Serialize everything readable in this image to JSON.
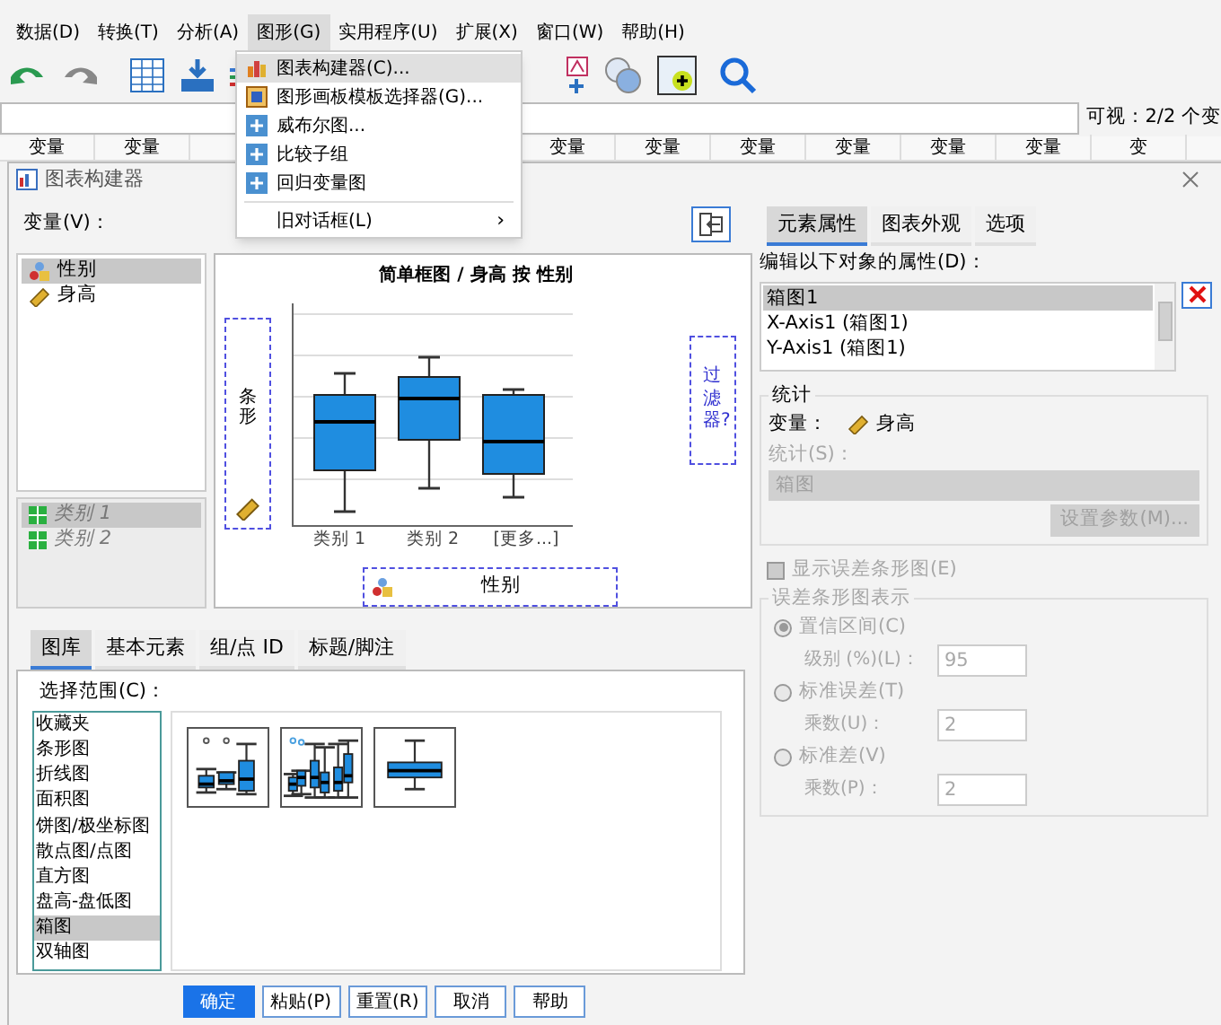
{
  "menu_bar": [
    {
      "label": "数据(D)",
      "selected": false
    },
    {
      "label": "转换(T)",
      "selected": false
    },
    {
      "label": "分析(A)",
      "selected": false
    },
    {
      "label": "图形(G)",
      "selected": true
    },
    {
      "label": "实用程序(U)",
      "selected": false
    },
    {
      "label": "扩展(X)",
      "selected": false
    },
    {
      "label": "窗口(W)",
      "selected": false
    },
    {
      "label": "帮助(H)",
      "selected": false
    }
  ],
  "data_view": {
    "visible_count": "可视：2/2 个变",
    "headers_left": [
      "变量",
      "变量"
    ],
    "headers_right": [
      "变量",
      "变量",
      "变量",
      "变量",
      "变量",
      "变量",
      "变"
    ]
  },
  "graphs_menu": [
    {
      "label": "图表构建器(C)...",
      "selected": true,
      "kind": "builder"
    },
    {
      "label": "图形画板模板选择器(G)...",
      "selected": false,
      "kind": "board"
    },
    {
      "label": "威布尔图...",
      "selected": false,
      "kind": "plus"
    },
    {
      "label": "比较子组",
      "selected": false,
      "kind": "plus"
    },
    {
      "label": "回归变量图",
      "selected": false,
      "kind": "plus"
    },
    {
      "label": "旧对话框(L)",
      "selected": false,
      "kind": "submenu",
      "arrow": "›"
    }
  ],
  "dialog": {
    "title": "图表构建器",
    "variables_label": "变量(V)：",
    "variables": [
      {
        "label": "性别",
        "selected": true,
        "kind": "nominal"
      },
      {
        "label": "身高",
        "selected": false,
        "kind": "scale"
      }
    ],
    "categories": [
      {
        "label": "类别 1",
        "selected": true
      },
      {
        "label": "类别 2",
        "selected": false
      }
    ],
    "canvas": {
      "title": "简单框图 / 身高 按 性别",
      "y_zone": "条形",
      "x_zone": "性别",
      "filter_zone": "过滤器?",
      "x_labels": [
        "类别 1",
        "类别 2",
        "[更多...]"
      ]
    },
    "gallery_tabs": [
      {
        "label": "图库",
        "selected": true
      },
      {
        "label": "基本元素",
        "selected": false
      },
      {
        "label": "组/点 ID",
        "selected": false
      },
      {
        "label": "标题/脚注",
        "selected": false
      }
    ],
    "choose_from_label": "选择范围(C)：",
    "chart_types": [
      {
        "label": "收藏夹",
        "selected": false
      },
      {
        "label": "条形图",
        "selected": false
      },
      {
        "label": "折线图",
        "selected": false
      },
      {
        "label": "面积图",
        "selected": false
      },
      {
        "label": "饼图/极坐标图",
        "selected": false
      },
      {
        "label": "散点图/点图",
        "selected": false
      },
      {
        "label": "直方图",
        "selected": false
      },
      {
        "label": "盘高-盘低图",
        "selected": false
      },
      {
        "label": "箱图",
        "selected": true
      },
      {
        "label": "双轴图",
        "selected": false
      }
    ],
    "gallery": [
      {
        "kind": "simple"
      },
      {
        "kind": "clustered"
      },
      {
        "kind": "one_d"
      }
    ],
    "buttons": [
      {
        "label": "确定",
        "primary": true
      },
      {
        "label": "粘贴(P)",
        "primary": false
      },
      {
        "label": "重置(R)",
        "primary": false
      },
      {
        "label": "取消",
        "primary": false
      },
      {
        "label": "帮助",
        "primary": false
      }
    ],
    "right_tabs": [
      {
        "label": "元素属性",
        "selected": true
      },
      {
        "label": "图表外观",
        "selected": false
      },
      {
        "label": "选项",
        "selected": false
      }
    ],
    "edit_label": "编辑以下对象的属性(D)：",
    "elements": [
      {
        "label": "箱图1",
        "selected": true
      },
      {
        "label": "X-Axis1 (箱图1)",
        "selected": false
      },
      {
        "label": "Y-Axis1 (箱图1)",
        "selected": false
      }
    ],
    "statistics": {
      "legend": "统计",
      "variable_label": "变量：",
      "variable": "身高",
      "stat_label": "统计(S)：",
      "stat_value": "箱图",
      "param_button": "设置参数(M)...",
      "disabled": true
    },
    "error_bars_checkbox": {
      "label": "显示误差条形图(E)",
      "checked": false,
      "disabled": true
    },
    "error_group": {
      "legend": "误差条形图表示",
      "disabled": true,
      "options": [
        {
          "label": "置信区间(C)",
          "selected": true,
          "field_label": "级别 (%)(L)：",
          "field_value": "95"
        },
        {
          "label": "标准误差(T)",
          "selected": false,
          "field_label": "乘数(U)：",
          "field_value": "2"
        },
        {
          "label": "标准差(V)",
          "selected": false,
          "field_label": "乘数(P)：",
          "field_value": "2"
        }
      ]
    }
  }
}
